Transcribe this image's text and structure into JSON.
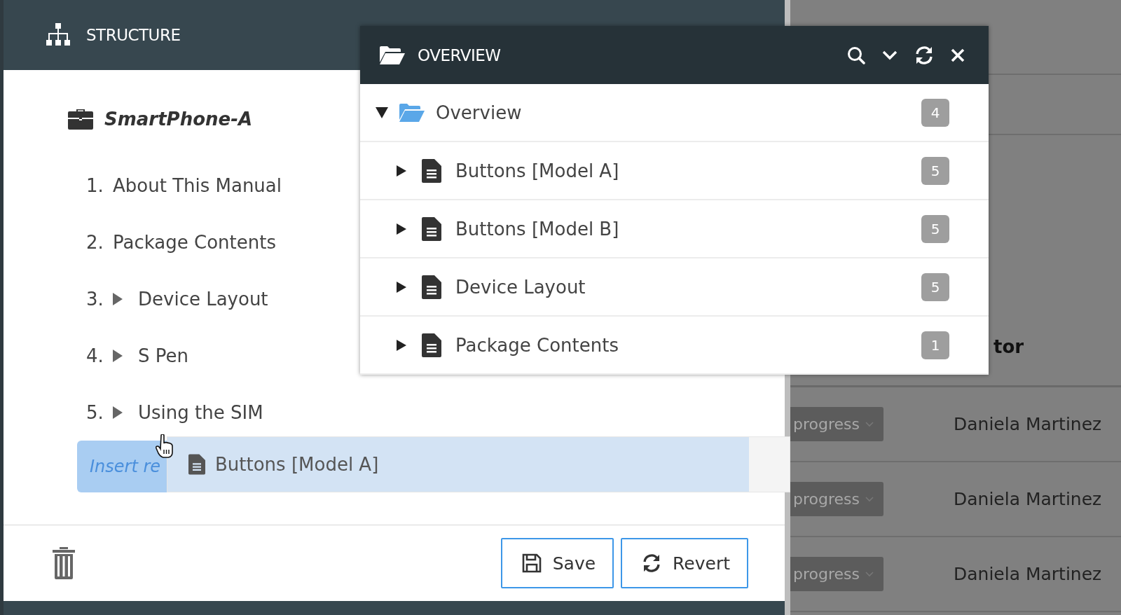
{
  "structure": {
    "title": "STRUCTURE",
    "root": "SmartPhone-A",
    "items": [
      {
        "number": "1.",
        "label": "About This Manual",
        "kind": "page"
      },
      {
        "number": "2.",
        "label": "Package Contents",
        "kind": "page"
      },
      {
        "number": "3.",
        "label": "Device Layout",
        "kind": "chapter"
      },
      {
        "number": "4.",
        "label": "S Pen",
        "kind": "chapter"
      },
      {
        "number": "5.",
        "label": "Using the SIM",
        "kind": "chapter"
      }
    ],
    "drop_placeholder": "Insert re",
    "drag_item": "Buttons [Model A]",
    "buttons": [
      {
        "label": "Save",
        "kind": "save"
      },
      {
        "label": "Revert",
        "kind": "revert"
      }
    ]
  },
  "background_table": {
    "column_header": "tor",
    "rows": [
      {
        "status": "progress",
        "assignee": "Daniela Martinez"
      },
      {
        "status": "progress",
        "assignee": "Daniela Martinez"
      },
      {
        "status": "progress",
        "assignee": "Daniela Martinez"
      }
    ]
  },
  "overview": {
    "title": "OVERVIEW",
    "root": {
      "label": "Overview",
      "count": "4",
      "expanded": true
    },
    "children": [
      {
        "label": "Buttons [Model A]",
        "count": "5",
        "expanded": false
      },
      {
        "label": "Buttons [Model B]",
        "count": "5",
        "expanded": false
      },
      {
        "label": "Device Layout",
        "count": "5",
        "expanded": false
      },
      {
        "label": "Package Contents",
        "count": "1",
        "expanded": false
      }
    ]
  }
}
